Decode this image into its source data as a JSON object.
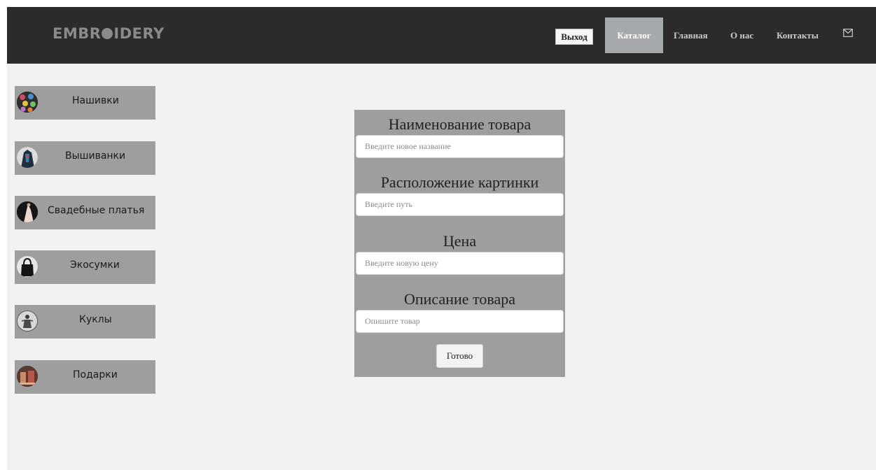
{
  "header": {
    "logo_left": "EMBR",
    "logo_right": "IDERY",
    "logout_label": "Выход",
    "nav": [
      {
        "label": "Каталог",
        "active": true
      },
      {
        "label": "Главная",
        "active": false
      },
      {
        "label": "О нас",
        "active": false
      },
      {
        "label": "Контакты",
        "active": false
      }
    ],
    "mail_icon": "envelope-icon"
  },
  "sidebar": {
    "items": [
      {
        "label": "Нашивки",
        "icon": "patches-thumbnail"
      },
      {
        "label": "Вышиванки",
        "icon": "embroidered-shirt-thumbnail"
      },
      {
        "label": "Свадебные платья",
        "icon": "wedding-dress-thumbnail"
      },
      {
        "label": "Экосумки",
        "icon": "eco-bag-thumbnail"
      },
      {
        "label": "Куклы",
        "icon": "doll-thumbnail"
      },
      {
        "label": "Подарки",
        "icon": "gift-thumbnail"
      }
    ]
  },
  "form": {
    "name_title": "Наименование товара",
    "name_placeholder": "Введите новое название",
    "image_title": "Расположение картинки",
    "image_placeholder": "Введите путь",
    "price_title": "Цена",
    "price_placeholder": "Введите новую цену",
    "description_title": "Описание товара",
    "description_placeholder": "Опишите товар",
    "submit_label": "Готово"
  },
  "colors": {
    "header_bg": "#2b2b2b",
    "page_bg": "#f2f2f2",
    "panel_gray": "#9e9e9e",
    "active_nav_bg": "#a6a9ab"
  }
}
